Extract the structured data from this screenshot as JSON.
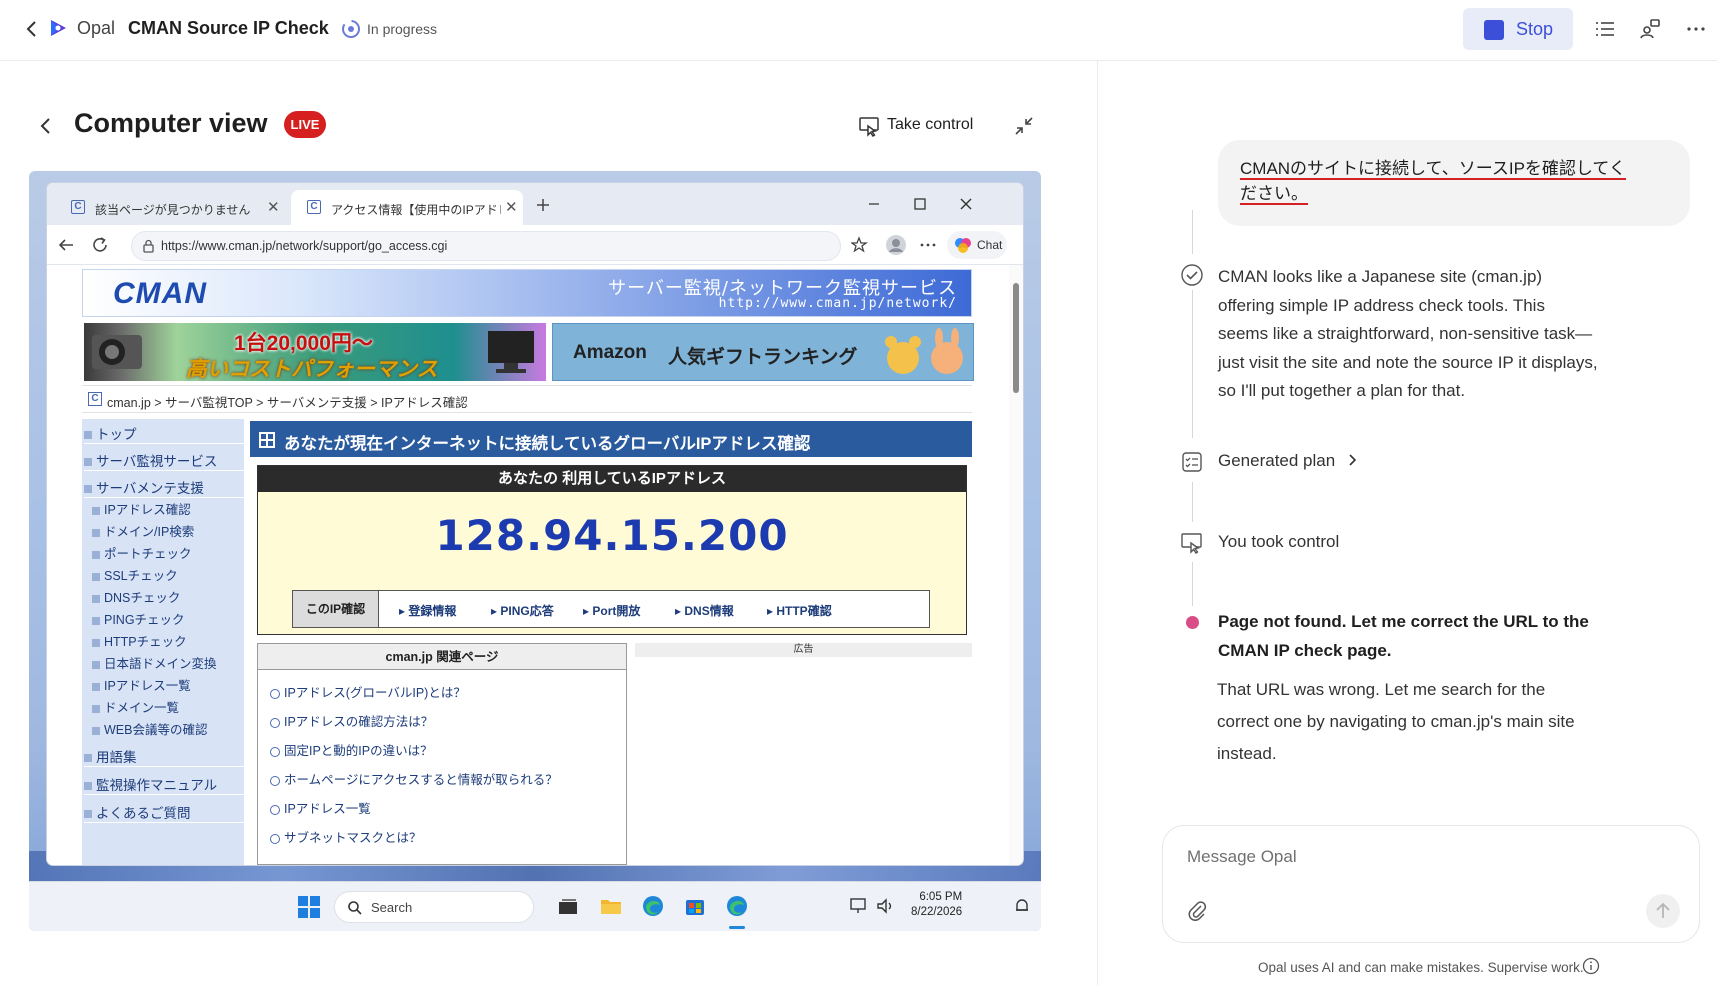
{
  "app": {
    "name": "Opal",
    "task_title": "CMAN Source IP Check",
    "status": "In progress",
    "stop_label": "Stop",
    "accent_color": "#3b4fd8"
  },
  "computer_view": {
    "title": "Computer view",
    "live_badge": "LIVE",
    "take_control_label": "Take control"
  },
  "browser": {
    "tabs": [
      {
        "label": "該当ページが見つかりません",
        "active": false
      },
      {
        "label": "アクセス情報【使用中のIPアドレス確認",
        "active": true
      }
    ],
    "url": "https://www.cman.jp/network/support/go_access.cgi",
    "chat_label": "Chat"
  },
  "site": {
    "logo": "CMAN",
    "tagline_jp": "サーバー監視/ネットワーク監視サービス",
    "tagline_url": "http://www.cman.jp/network/",
    "ad_left_line1": "1台20,000円〜",
    "ad_left_line2": "高いコストパフォーマンス",
    "ad_right_brand": "Amazon",
    "ad_right_text": "人気ギフトランキング",
    "breadcrumb": "cman.jp > サーバ監視TOP > サーバメンテ支援 > IPアドレス確認",
    "nav_top": [
      "トップ",
      "サーバ監視サービス",
      "サーバメンテ支援"
    ],
    "nav_sub": [
      "IPアドレス確認",
      "ドメイン/IP検索",
      "ポートチェック",
      "SSLチェック",
      "DNSチェック",
      "PINGチェック",
      "HTTPチェック",
      "日本語ドメイン変換",
      "IPアドレス一覧",
      "ドメイン一覧",
      "WEB会議等の確認"
    ],
    "nav_bottom": [
      "用語集",
      "監視操作マニュアル",
      "よくあるご質問"
    ],
    "content_title": "あなたが現在インターネットに接続しているグローバルIPアドレス確認",
    "ip_box_header": "あなたの 利用しているIPアドレス",
    "ip_address": "128.94.15.200",
    "ip_links_first": "このIP確認",
    "ip_links": [
      "登録情報",
      "PING応答",
      "Port開放",
      "DNS情報",
      "HTTP確認"
    ],
    "related_header": "cman.jp 関連ページ",
    "related_items": [
      "IPアドレス(グローバルIP)とは？",
      "IPアドレスの確認方法は？",
      "固定IPと動的IPの違いは？",
      "ホームページにアクセスすると情報が取られる？",
      "IPアドレス一覧",
      "サブネットマスクとは？"
    ],
    "ad_label": "広告"
  },
  "taskbar": {
    "search_label": "Search",
    "time": "6:05 PM",
    "date": "8/22/2026"
  },
  "chat": {
    "user_message_line1": "CMANのサイトに接続して、ソースIPを確認してく",
    "user_message_line2": "ださい。",
    "assistant_thought": "CMAN looks like a Japanese site (cman.jp) offering simple IP address check tools. This seems like a straightforward, non-sensitive task—just visit the site and note the source IP it displays, so I'll put together a plan for that.",
    "generated_plan_label": "Generated plan",
    "took_control_label": "You took control",
    "status_heading": "Page not found. Let me correct the URL to the CMAN IP check page.",
    "status_body": "That URL was wrong. Let me search for the correct one by navigating to cman.jp's main site instead.",
    "composer_placeholder": "Message Opal",
    "disclaimer": "Opal uses AI and can make mistakes. Supervise work."
  }
}
